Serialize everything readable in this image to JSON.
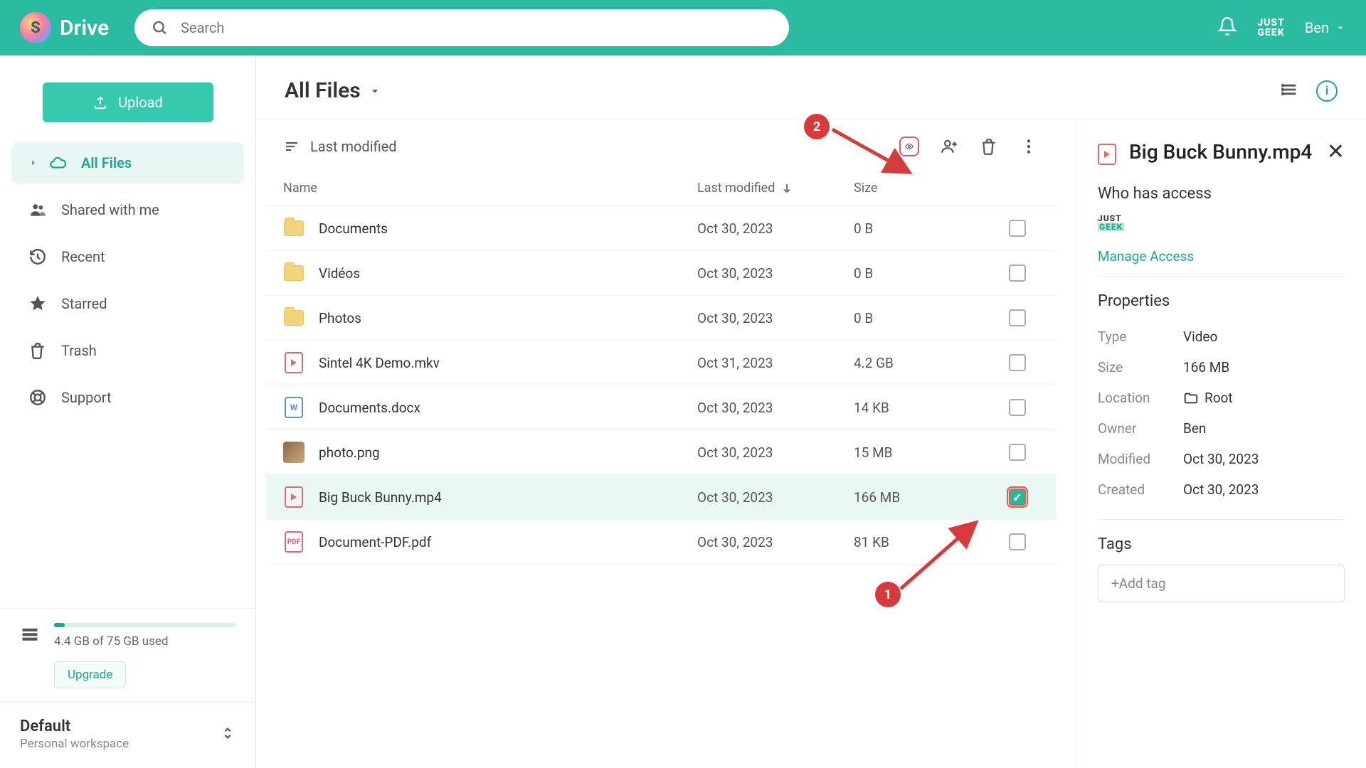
{
  "app": {
    "name": "Drive"
  },
  "search": {
    "placeholder": "Search"
  },
  "header": {
    "brand_l1": "JUST",
    "brand_l2": "GEEK",
    "user": "Ben"
  },
  "upload_label": "Upload",
  "nav": {
    "all_files": "All Files",
    "shared": "Shared with me",
    "recent": "Recent",
    "starred": "Starred",
    "trash": "Trash",
    "support": "Support"
  },
  "storage": {
    "text": "4.4 GB of 75 GB used",
    "upgrade": "Upgrade"
  },
  "workspace": {
    "name": "Default",
    "sub": "Personal workspace"
  },
  "breadcrumb": "All Files",
  "sort_label": "Last modified",
  "columns": {
    "name": "Name",
    "modified": "Last modified",
    "size": "Size"
  },
  "files": [
    {
      "name": "Documents",
      "type": "folder",
      "modified": "Oct 30, 2023",
      "size": "0 B",
      "checked": false
    },
    {
      "name": "Vidéos",
      "type": "folder",
      "modified": "Oct 30, 2023",
      "size": "0 B",
      "checked": false
    },
    {
      "name": "Photos",
      "type": "folder",
      "modified": "Oct 30, 2023",
      "size": "0 B",
      "checked": false
    },
    {
      "name": "Sintel 4K Demo.mkv",
      "type": "video",
      "modified": "Oct 31, 2023",
      "size": "4.2 GB",
      "checked": false
    },
    {
      "name": "Documents.docx",
      "type": "word",
      "modified": "Oct 30, 2023",
      "size": "14 KB",
      "checked": false
    },
    {
      "name": "photo.png",
      "type": "image",
      "modified": "Oct 30, 2023",
      "size": "15 MB",
      "checked": false
    },
    {
      "name": "Big Buck Bunny.mp4",
      "type": "video",
      "modified": "Oct 30, 2023",
      "size": "166 MB",
      "checked": true
    },
    {
      "name": "Document-PDF.pdf",
      "type": "pdf",
      "modified": "Oct 30, 2023",
      "size": "81 KB",
      "checked": false
    }
  ],
  "details": {
    "title": "Big Buck Bunny.mp4",
    "access_heading": "Who has access",
    "manage": "Manage Access",
    "properties_heading": "Properties",
    "props": {
      "type_k": "Type",
      "type_v": "Video",
      "size_k": "Size",
      "size_v": "166 MB",
      "location_k": "Location",
      "location_v": "Root",
      "owner_k": "Owner",
      "owner_v": "Ben",
      "modified_k": "Modified",
      "modified_v": "Oct 30, 2023",
      "created_k": "Created",
      "created_v": "Oct 30, 2023"
    },
    "tags_heading": "Tags",
    "tags_placeholder": "+Add tag"
  },
  "annotations": {
    "n1": "1",
    "n2": "2"
  }
}
